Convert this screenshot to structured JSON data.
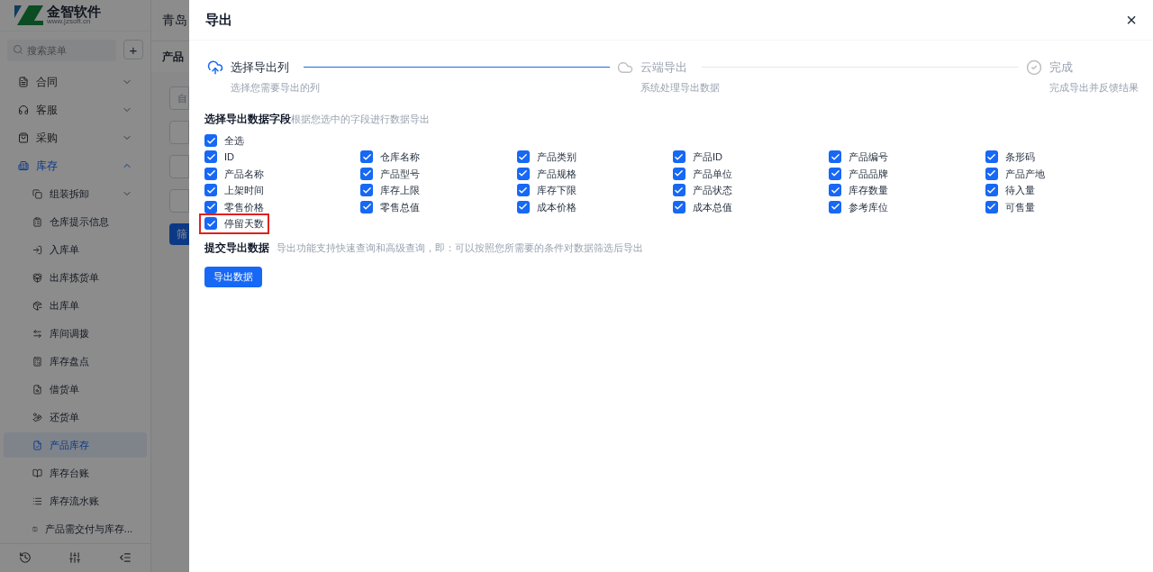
{
  "brand": {
    "name": "金智软件",
    "url": "www.jzsoft.cn"
  },
  "header": {
    "title": "青岛"
  },
  "sidebar": {
    "search": {
      "placeholder": "搜索菜单"
    },
    "add_button": "+",
    "items": [
      {
        "label": "合同",
        "expanded": false,
        "selected": false
      },
      {
        "label": "客服",
        "expanded": false,
        "selected": false
      },
      {
        "label": "采购",
        "expanded": false,
        "selected": false
      },
      {
        "label": "库存",
        "expanded": true,
        "selected": true,
        "children": [
          {
            "label": "组装拆卸",
            "expanded": false,
            "selected": false
          },
          {
            "label": "仓库提示信息",
            "selected": false
          },
          {
            "label": "入库单",
            "selected": false
          },
          {
            "label": "出库拣货单",
            "selected": false
          },
          {
            "label": "出库单",
            "selected": false
          },
          {
            "label": "库间调拨",
            "selected": false
          },
          {
            "label": "库存盘点",
            "selected": false
          },
          {
            "label": "借货单",
            "selected": false
          },
          {
            "label": "还货单",
            "selected": false
          },
          {
            "label": "产品库存",
            "selected": true
          },
          {
            "label": "库存台账",
            "selected": false
          },
          {
            "label": "库存流水账",
            "selected": false
          },
          {
            "label": "产品需交付与库存...",
            "selected": false
          }
        ]
      }
    ]
  },
  "main": {
    "tab": "产品",
    "field": "自",
    "button": "筛"
  },
  "dialog": {
    "title": "导出",
    "close": "×",
    "steps": [
      {
        "title": "选择导出列",
        "description": "选择您需要导出的列",
        "active": true
      },
      {
        "title": "云端导出",
        "description": "系统处理导出数据",
        "active": false
      },
      {
        "title": "完成",
        "description": "完成导出并反馈结果",
        "active": false
      }
    ],
    "fields_section": {
      "title": "选择导出数据字段",
      "hint": "根据您选中的字段进行数据导出",
      "select_all": {
        "label": "全选",
        "checked": true
      },
      "fields": [
        {
          "label": "ID",
          "checked": true,
          "highlighted": false
        },
        {
          "label": "仓库名称",
          "checked": true,
          "highlighted": false
        },
        {
          "label": "产品类别",
          "checked": true,
          "highlighted": false
        },
        {
          "label": "产品ID",
          "checked": true,
          "highlighted": false
        },
        {
          "label": "产品编号",
          "checked": true,
          "highlighted": false
        },
        {
          "label": "条形码",
          "checked": true,
          "highlighted": false
        },
        {
          "label": "产品名称",
          "checked": true,
          "highlighted": false
        },
        {
          "label": "产品型号",
          "checked": true,
          "highlighted": false
        },
        {
          "label": "产品规格",
          "checked": true,
          "highlighted": false
        },
        {
          "label": "产品单位",
          "checked": true,
          "highlighted": false
        },
        {
          "label": "产品品牌",
          "checked": true,
          "highlighted": false
        },
        {
          "label": "产品产地",
          "checked": true,
          "highlighted": false
        },
        {
          "label": "上架时间",
          "checked": true,
          "highlighted": false
        },
        {
          "label": "库存上限",
          "checked": true,
          "highlighted": false
        },
        {
          "label": "库存下限",
          "checked": true,
          "highlighted": false
        },
        {
          "label": "产品状态",
          "checked": true,
          "highlighted": false
        },
        {
          "label": "库存数量",
          "checked": true,
          "highlighted": false
        },
        {
          "label": "待入量",
          "checked": true,
          "highlighted": false
        },
        {
          "label": "零售价格",
          "checked": true,
          "highlighted": false
        },
        {
          "label": "零售总值",
          "checked": true,
          "highlighted": false
        },
        {
          "label": "成本价格",
          "checked": true,
          "highlighted": false
        },
        {
          "label": "成本总值",
          "checked": true,
          "highlighted": false
        },
        {
          "label": "参考库位",
          "checked": true,
          "highlighted": false
        },
        {
          "label": "可售量",
          "checked": true,
          "highlighted": false
        },
        {
          "label": "停留天数",
          "checked": true,
          "highlighted": true
        }
      ]
    },
    "submit_section": {
      "title": "提交导出数据",
      "hint": "导出功能支持快速查询和高级查询，即：可以按照您所需要的条件对数据筛选后导出",
      "button": "导出数据"
    }
  }
}
